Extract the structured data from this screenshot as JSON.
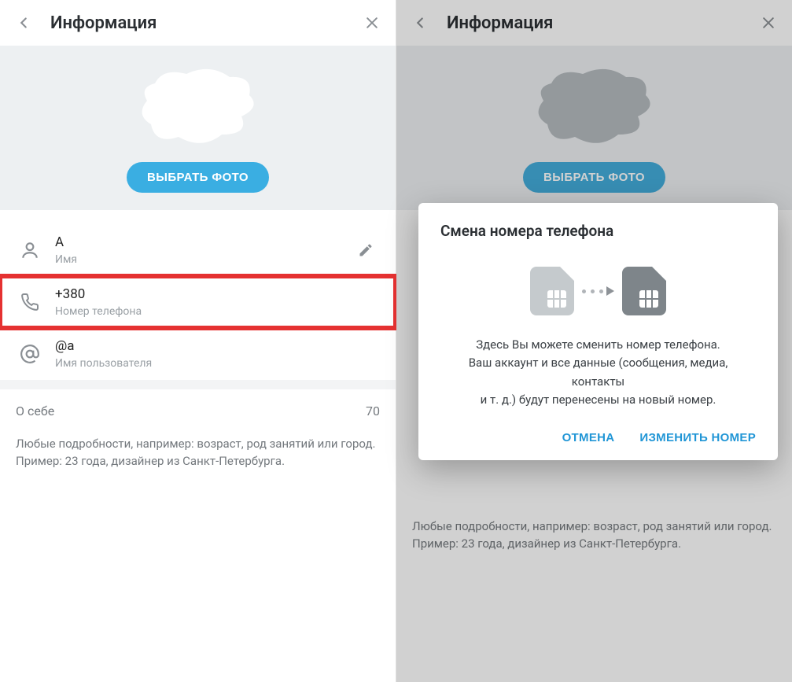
{
  "left": {
    "header": {
      "title": "Информация"
    },
    "choose_photo": "ВЫБРАТЬ ФОТО",
    "name_row": {
      "value": "A",
      "label": "Имя"
    },
    "phone_row": {
      "value": "+380",
      "label": "Номер телефона"
    },
    "username_row": {
      "value": "@a",
      "label": "Имя пользователя"
    },
    "about": {
      "label": "О себе",
      "limit": "70"
    },
    "about_hint_1": "Любые подробности, например: возраст, род занятий или город.",
    "about_hint_2": "Пример: 23 года, дизайнер из Санкт-Петербурга."
  },
  "right": {
    "header": {
      "title": "Информация"
    },
    "choose_photo": "ВЫБРАТЬ ФОТО",
    "about_hint_1": "Любые подробности, например: возраст, род занятий или город.",
    "about_hint_2": "Пример: 23 года, дизайнер из Санкт-Петербурга."
  },
  "dialog": {
    "title": "Смена номера телефона",
    "body_1": "Здесь Вы можете сменить номер телефона.",
    "body_2": "Ваш аккаунт и все данные (сообщения, медиа, контакты",
    "body_3": "и т. д.) будут перенесены на новый номер.",
    "cancel": "ОТМЕНА",
    "confirm": "ИЗМЕНИТЬ НОМЕР"
  },
  "colors": {
    "accent": "#3aaee2",
    "highlight": "#e53131",
    "link": "#2196d6"
  }
}
